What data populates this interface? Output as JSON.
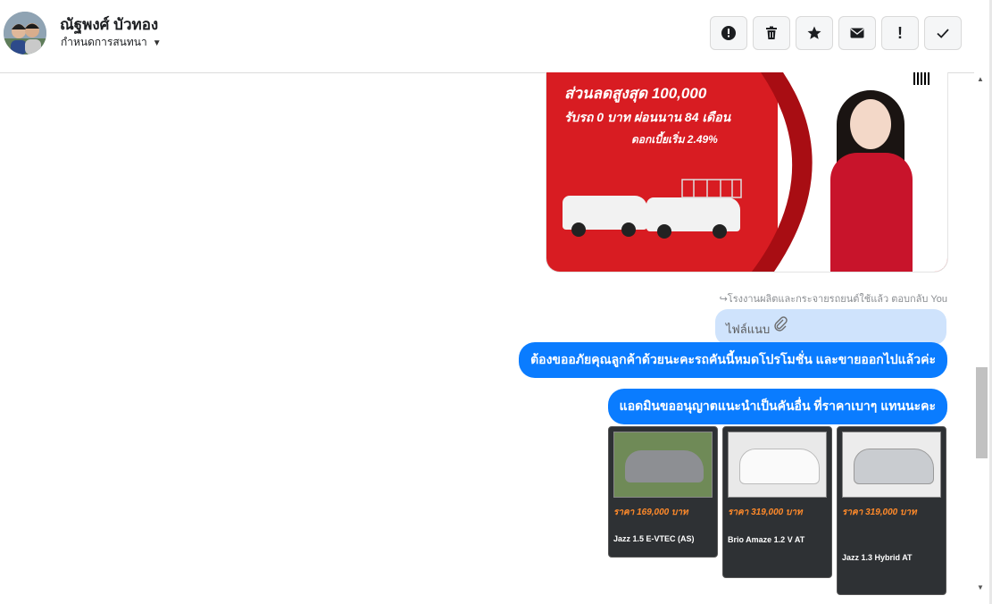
{
  "header": {
    "contact_name": "ณัฐพงศ์ บัวทอง",
    "subtitle": "กำหนดการสนทนา"
  },
  "toolbar": {
    "buttons": [
      {
        "name": "report-button",
        "icon": "alert-circle-icon"
      },
      {
        "name": "delete-button",
        "icon": "trash-icon"
      },
      {
        "name": "star-button",
        "icon": "star-icon"
      },
      {
        "name": "mail-button",
        "icon": "envelope-icon"
      },
      {
        "name": "important-button",
        "icon": "exclamation-icon",
        "glyph": "!"
      },
      {
        "name": "done-button",
        "icon": "checkmark-icon"
      }
    ]
  },
  "promo": {
    "line1": "ส่วนลดสูงสุด 100,000",
    "line2": "รับรถ 0 บาท ผ่อนนาน 84 เดือน",
    "line3": "ดอกเบี้ยเริ่ม 2.49%"
  },
  "chat": {
    "status_line": "↪โรงงานผลิตและกระจายรถยนต์ใช้แล้ว ตอบกลับ You",
    "attachment_label": "ไฟล์แนบ",
    "messages": [
      {
        "text": "ต้องขออภัยคุณลูกค้าด้วยนะคะรถคันนี้หมดโปรโมชั่น และขายออกไปแล้วค่ะ"
      },
      {
        "text": "แอดมินขออนุญาตแนะนำเป็นคันอื่น ที่ราคาเบาๆ แทนนะคะ"
      }
    ]
  },
  "cards": [
    {
      "price": "ราคา 169,000 บาท",
      "model": "Jazz 1.5 E-VTEC (AS)"
    },
    {
      "price": "ราคา 319,000 บาท",
      "model": "Brio Amaze 1.2 V AT"
    },
    {
      "price": "ราคา 319,000 บาท",
      "model": "Jazz 1.3 Hybrid AT"
    }
  ],
  "colors": {
    "accent": "#0a7cff",
    "attachment_bg": "#cfe3fc",
    "promo_red": "#d81c22"
  }
}
